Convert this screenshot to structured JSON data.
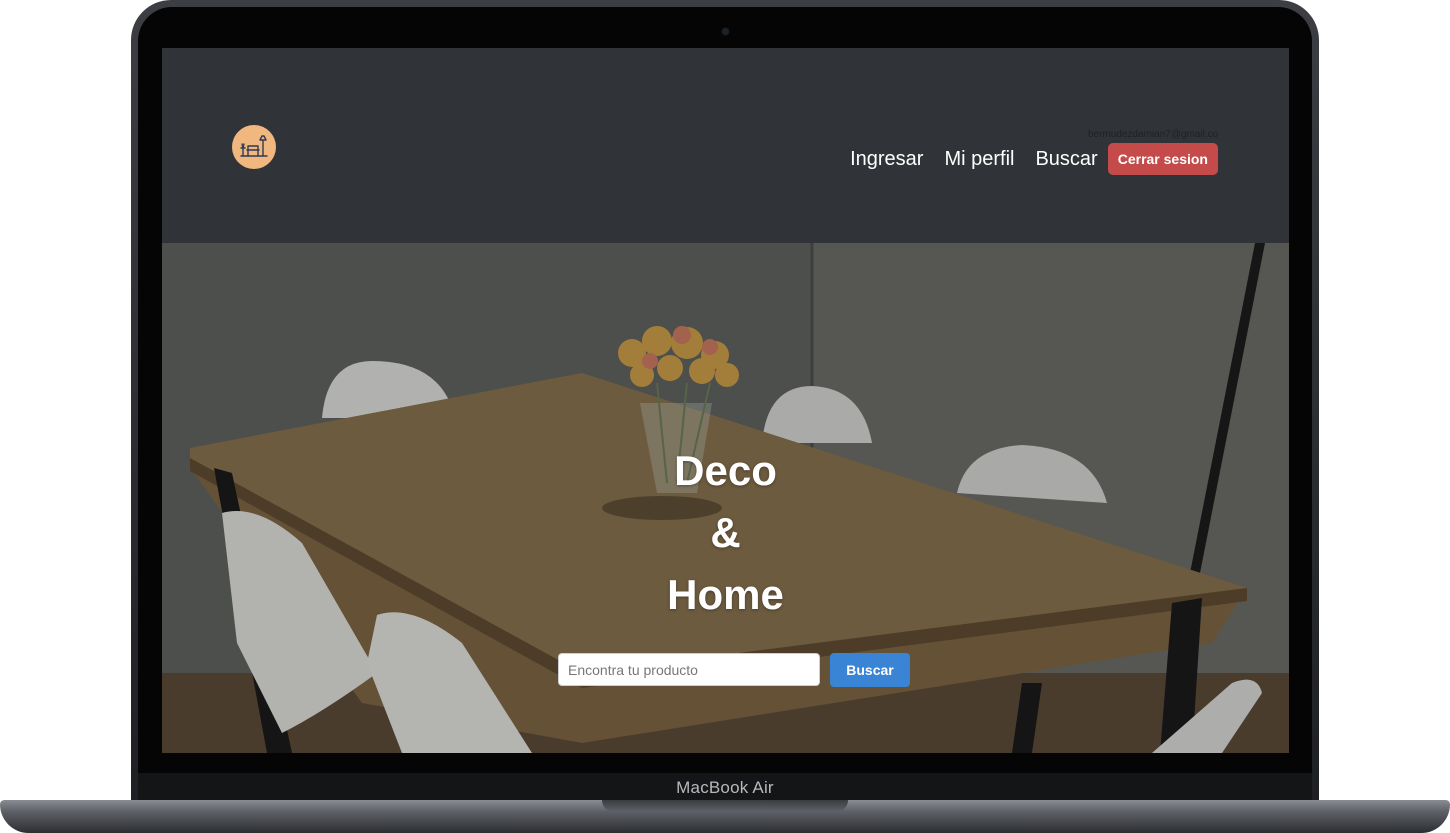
{
  "device": {
    "model_label": "MacBook Air"
  },
  "navbar": {
    "user_email": "bermudezdamian7@gmail.com",
    "links": [
      "Ingresar",
      "Mi perfil",
      "Buscar"
    ],
    "logout_label": "Cerrar sesion",
    "logo_icon": "furniture-logo-icon",
    "background_color": "#303438"
  },
  "hero": {
    "title_line1": "Deco",
    "title_line2": "&",
    "title_line3": "Home",
    "search": {
      "placeholder": "Encontra tu producto",
      "value": "",
      "button_label": "Buscar"
    }
  },
  "colors": {
    "logout_button": "#c54a4a",
    "search_button": "#3a84d6",
    "logo_background": "#f0b77f"
  }
}
